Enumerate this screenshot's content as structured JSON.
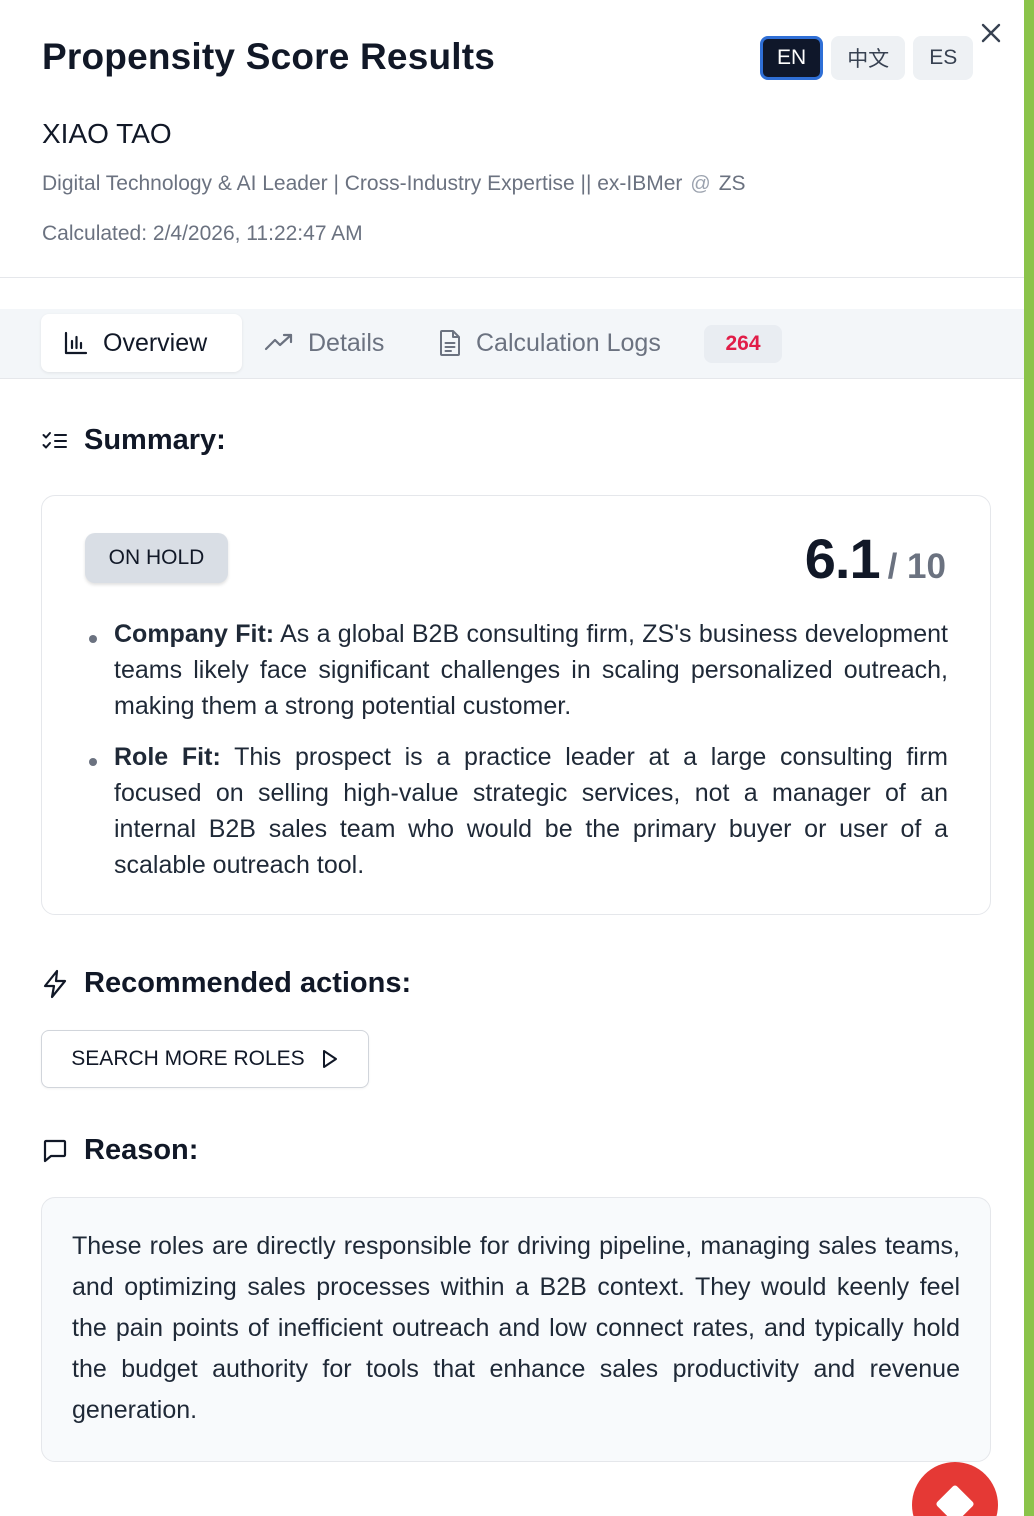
{
  "header": {
    "title": "Propensity Score Results",
    "languages": [
      "EN",
      "中文",
      "ES"
    ],
    "active_language": "EN",
    "close_icon": "close-icon"
  },
  "prospect": {
    "name": "XIAO TAO",
    "headline": "Digital Technology & AI Leader | Cross-Industry Expertise || ex-IBMer",
    "at_symbol": "@",
    "company": "ZS",
    "calculated": "Calculated: 2/4/2026, 11:22:47 AM"
  },
  "tabs": [
    {
      "label": "Overview",
      "icon": "bar-chart-icon",
      "active": true
    },
    {
      "label": "Details",
      "icon": "trending-up-icon",
      "active": false
    },
    {
      "label": "Calculation Logs",
      "icon": "document-icon",
      "active": false,
      "badge": "264"
    }
  ],
  "summary": {
    "heading": "Summary:",
    "status": "ON HOLD",
    "score": "6.1",
    "score_max": "/ 10",
    "points": [
      {
        "label": "Company Fit:",
        "text": "As a global B2B consulting firm, ZS's business development teams likely face significant challenges in scaling personalized outreach, making them a strong potential customer."
      },
      {
        "label": "Role Fit:",
        "text": "This prospect is a practice leader at a large consulting firm focused on selling high-value strategic services, not a manager of an internal B2B sales team who would be the primary buyer or user of a scalable outreach tool."
      }
    ]
  },
  "actions": {
    "heading": "Recommended actions:",
    "button_label": "SEARCH MORE ROLES"
  },
  "reason": {
    "heading": "Reason:",
    "text": "These roles are directly responsible for driving pipeline, managing sales teams, and optimizing sales processes within a B2B context. They would keenly feel the pain points of inefficient outreach and low connect rates, and typically hold the budget authority for tools that enhance sales productivity and revenue generation."
  },
  "colors": {
    "accent_edge": "#8bc34a",
    "badge_red": "#e11d48",
    "fab_red": "#e53935",
    "active_lang_bg": "#0f172a",
    "active_lang_border": "#2f6fd6"
  }
}
